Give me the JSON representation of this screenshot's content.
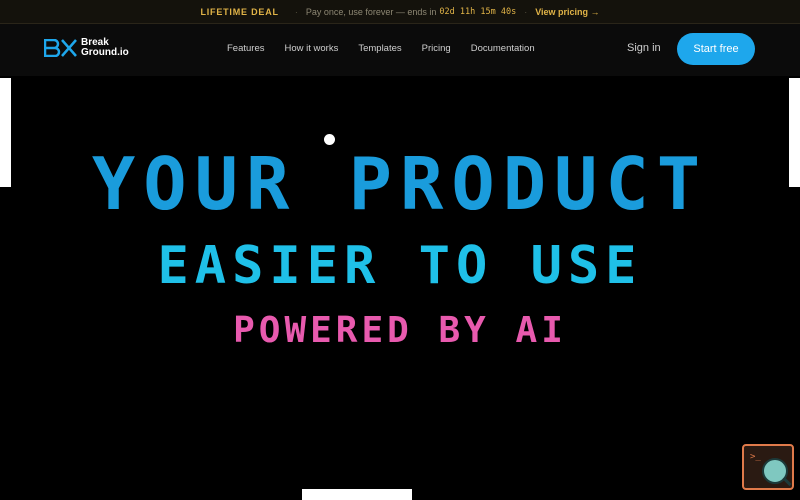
{
  "banner": {
    "deal": "LIFETIME DEAL",
    "text": "Pay once, use forever — ends in",
    "timer": "02d 11h 15m 40s",
    "link": "View pricing →"
  },
  "nav": {
    "logo_line1": "Break",
    "logo_line2": "Ground.io",
    "items": [
      "Features",
      "How it works",
      "Templates",
      "Pricing",
      "Documentation"
    ],
    "signin": "Sign in",
    "cta": "Start free"
  },
  "hero": {
    "line1": "YOUR PRODUCT",
    "line2": "EASIER TO USE",
    "line3": "POWERED BY AI"
  },
  "colors": {
    "accent": "#1ea7ec",
    "line1": "#1a9cdc",
    "line2": "#1fc0e8",
    "line3": "#e85aae",
    "banner_accent": "#e0b347"
  },
  "icons": {
    "logo": "breakground-logo-icon",
    "widget": "terminal-search-widget-icon"
  }
}
